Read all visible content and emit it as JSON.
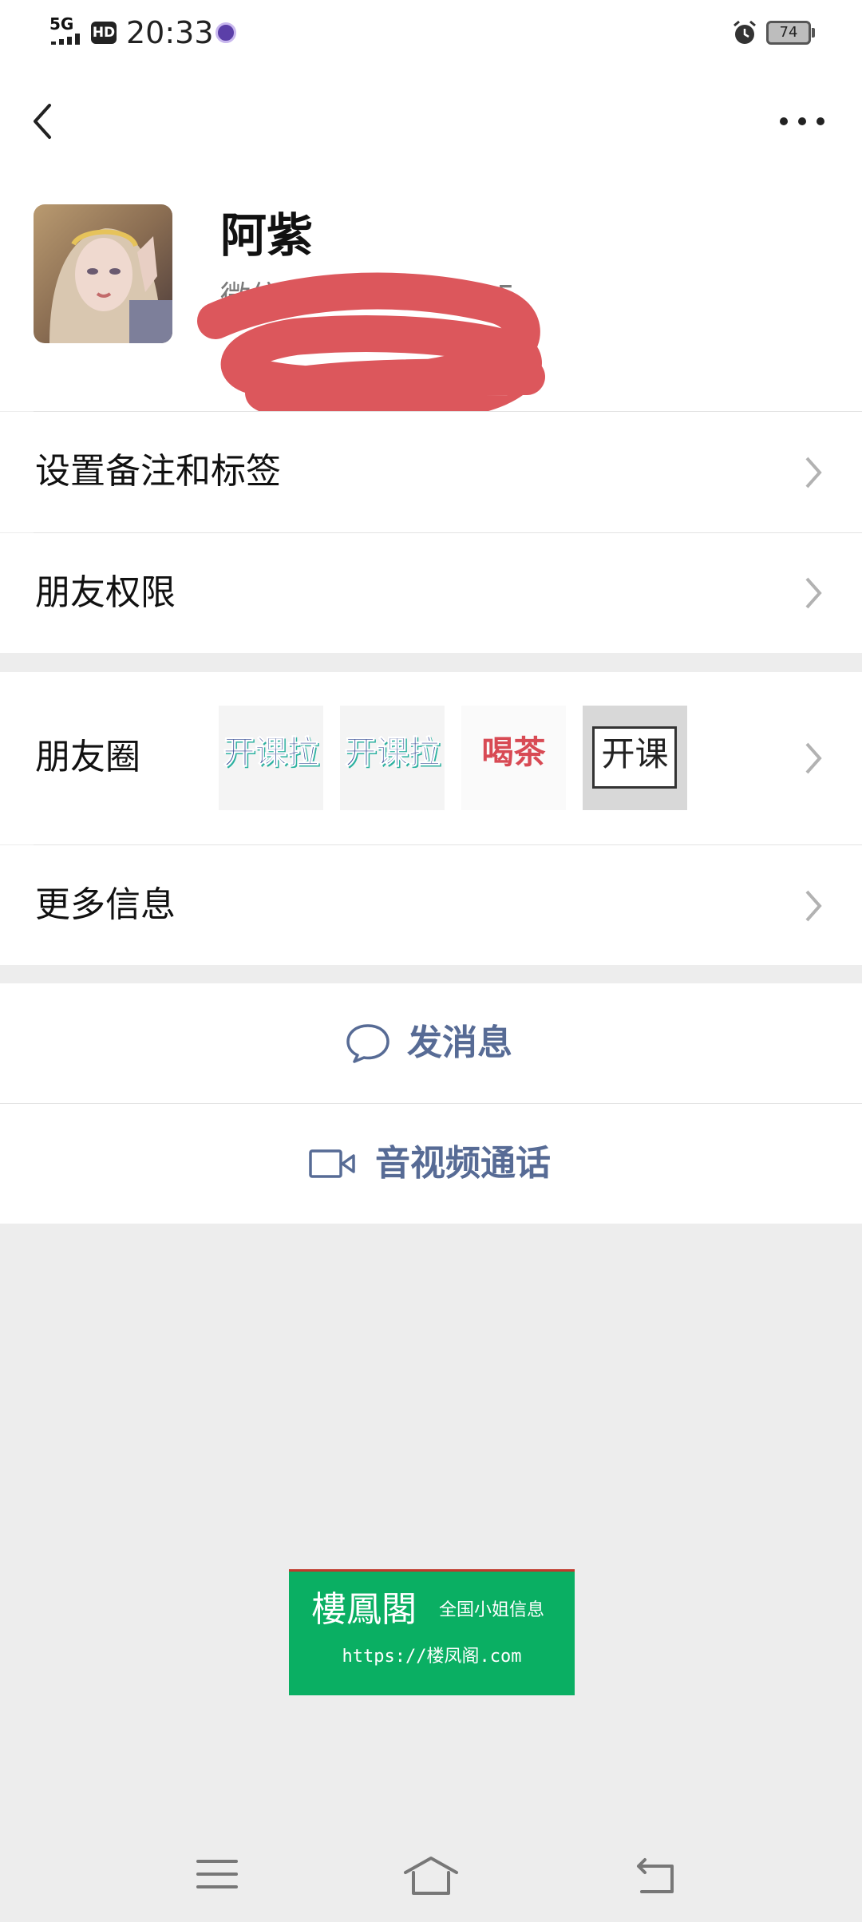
{
  "status_bar": {
    "network": "5G",
    "hd": "HD",
    "time": "20:33",
    "battery": "74"
  },
  "profile": {
    "nickname": "阿紫",
    "wechat_id_label": "微信",
    "wechat_id_tail": "5"
  },
  "rows": {
    "remark_tags": "设置备注和标签",
    "friend_permissions": "朋友权限",
    "moments": "朋友圈",
    "more_info": "更多信息"
  },
  "moments_thumbnails": [
    {
      "text": "开课拉"
    },
    {
      "text": "开课拉"
    },
    {
      "text": "喝茶"
    },
    {
      "text": "开课"
    }
  ],
  "actions": {
    "send_message": "发消息",
    "av_call": "音视频通话"
  },
  "ad": {
    "title": "樓鳳閣",
    "subtitle": "全国小姐信息",
    "url": "https://楼凤阁.com"
  },
  "colors": {
    "link_blue": "#576b95",
    "ad_green": "#0aaf63",
    "background_gray": "#ededed"
  }
}
